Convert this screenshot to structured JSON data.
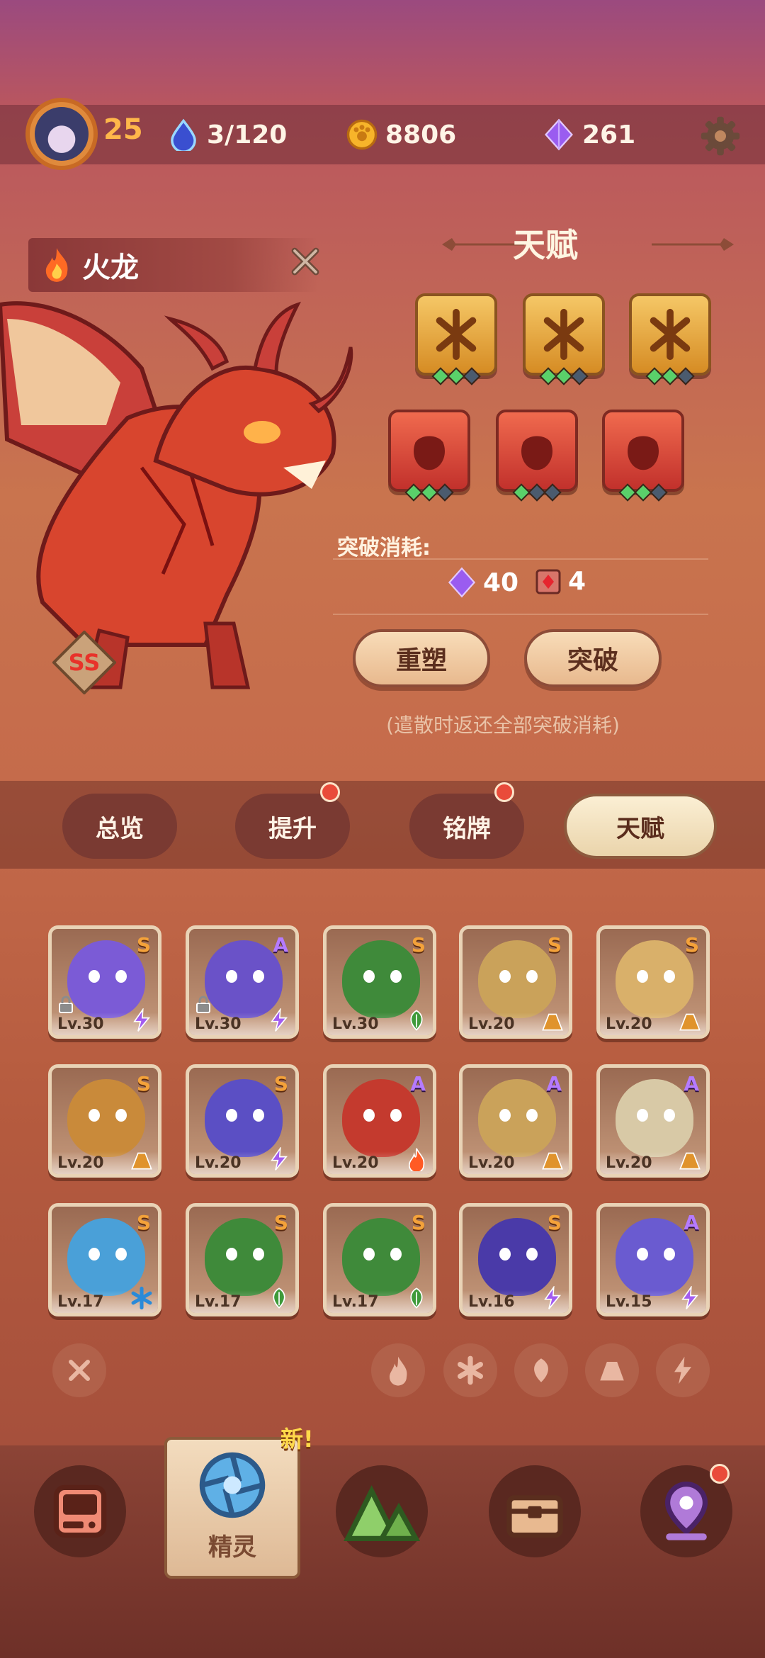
{
  "status": {
    "level": "25",
    "energy": "3/120",
    "coins": "8806",
    "gems": "261"
  },
  "creature": {
    "name": "火龙",
    "rank": "SS"
  },
  "talent": {
    "title": "天赋",
    "row1": [
      {
        "color": "gold",
        "gems": [
          1,
          1,
          0
        ]
      },
      {
        "color": "gold",
        "gems": [
          1,
          1,
          0
        ]
      },
      {
        "color": "gold",
        "gems": [
          1,
          1,
          0
        ]
      }
    ],
    "row2": [
      {
        "color": "red",
        "gems": [
          1,
          1,
          0
        ]
      },
      {
        "color": "red",
        "gems": [
          1,
          0,
          0
        ]
      },
      {
        "color": "red",
        "gems": [
          1,
          1,
          0
        ]
      }
    ],
    "cost_label": "突破消耗:",
    "cost_gems": "40",
    "cost_items": "4",
    "reshape_label": "重塑",
    "breakthrough_label": "突破",
    "note": "(遣散时返还全部突破消耗)"
  },
  "tabs": [
    {
      "label": "总览",
      "active": false,
      "dot": false
    },
    {
      "label": "提升",
      "active": false,
      "dot": true
    },
    {
      "label": "铭牌",
      "active": false,
      "dot": true
    },
    {
      "label": "天赋",
      "active": true,
      "dot": false
    }
  ],
  "creatures": [
    {
      "lv": "Lv.30",
      "rank": "S",
      "element": "electric",
      "color": "#7b5bd6",
      "locked": true
    },
    {
      "lv": "Lv.30",
      "rank": "A",
      "element": "electric",
      "color": "#6a52c8",
      "locked": true
    },
    {
      "lv": "Lv.30",
      "rank": "S",
      "element": "grass",
      "color": "#3f8a3a",
      "locked": false
    },
    {
      "lv": "Lv.20",
      "rank": "S",
      "element": "earth",
      "color": "#caa25a",
      "locked": false
    },
    {
      "lv": "Lv.20",
      "rank": "S",
      "element": "earth",
      "color": "#d9b06a",
      "locked": false
    },
    {
      "lv": "Lv.20",
      "rank": "S",
      "element": "earth",
      "color": "#c98a3a",
      "locked": false
    },
    {
      "lv": "Lv.20",
      "rank": "S",
      "element": "electric",
      "color": "#5b4fc4",
      "locked": false
    },
    {
      "lv": "Lv.20",
      "rank": "A",
      "element": "fire",
      "color": "#c43a2e",
      "locked": false
    },
    {
      "lv": "Lv.20",
      "rank": "A",
      "element": "earth",
      "color": "#caa25a",
      "locked": false
    },
    {
      "lv": "Lv.20",
      "rank": "A",
      "element": "earth",
      "color": "#d8c9a6",
      "locked": false
    },
    {
      "lv": "Lv.17",
      "rank": "S",
      "element": "ice",
      "color": "#4aa0d8",
      "locked": false
    },
    {
      "lv": "Lv.17",
      "rank": "S",
      "element": "grass",
      "color": "#3f8a3a",
      "locked": false
    },
    {
      "lv": "Lv.17",
      "rank": "S",
      "element": "grass",
      "color": "#3f8a3a",
      "locked": false
    },
    {
      "lv": "Lv.16",
      "rank": "S",
      "element": "electric",
      "color": "#4a3aa8",
      "locked": false
    },
    {
      "lv": "Lv.15",
      "rank": "A",
      "element": "electric",
      "color": "#6a5bd0",
      "locked": false
    }
  ],
  "filters": [
    "clear",
    "fire",
    "ice",
    "grass",
    "earth",
    "electric"
  ],
  "nav": {
    "active_label": "精灵",
    "new_badge": "新!"
  }
}
